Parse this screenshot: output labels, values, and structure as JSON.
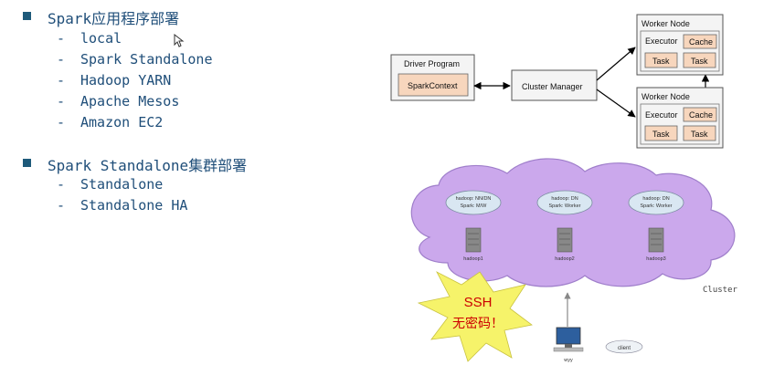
{
  "modes": {
    "heading": "Spark应用程序部署",
    "items": [
      "local",
      "Spark Standalone",
      "Hadoop YARN",
      "Apache Mesos",
      "Amazon EC2"
    ]
  },
  "cluster": {
    "heading": "Spark Standalone集群部署",
    "items": [
      "Standalone",
      "Standalone HA"
    ]
  },
  "diagram": {
    "driver_program": "Driver Program",
    "spark_context": "SparkContext",
    "cluster_manager": "Cluster Manager",
    "worker_node": "Worker Node",
    "executor": "Executor",
    "cache": "Cache",
    "task": "Task"
  },
  "deployment": {
    "nodes": [
      {
        "role1": "hadoop: NN/DN",
        "role2": "Spark: M/W",
        "host": "hadoop1"
      },
      {
        "role1": "hadoop: DN",
        "role2": "Spark: Worker",
        "host": "hadoop2"
      },
      {
        "role1": "hadoop: DN",
        "role2": "Spark: Worker",
        "host": "hadoop3"
      }
    ],
    "cluster_label": "Cluster",
    "ssh_line1": "SSH",
    "ssh_line2": "无密码！",
    "client_label": "client",
    "pc_label": "wyy",
    "colors": {
      "cloud": "#c9a4ec",
      "star": "#f6f36a",
      "ssh_text": "#cc0000"
    }
  }
}
